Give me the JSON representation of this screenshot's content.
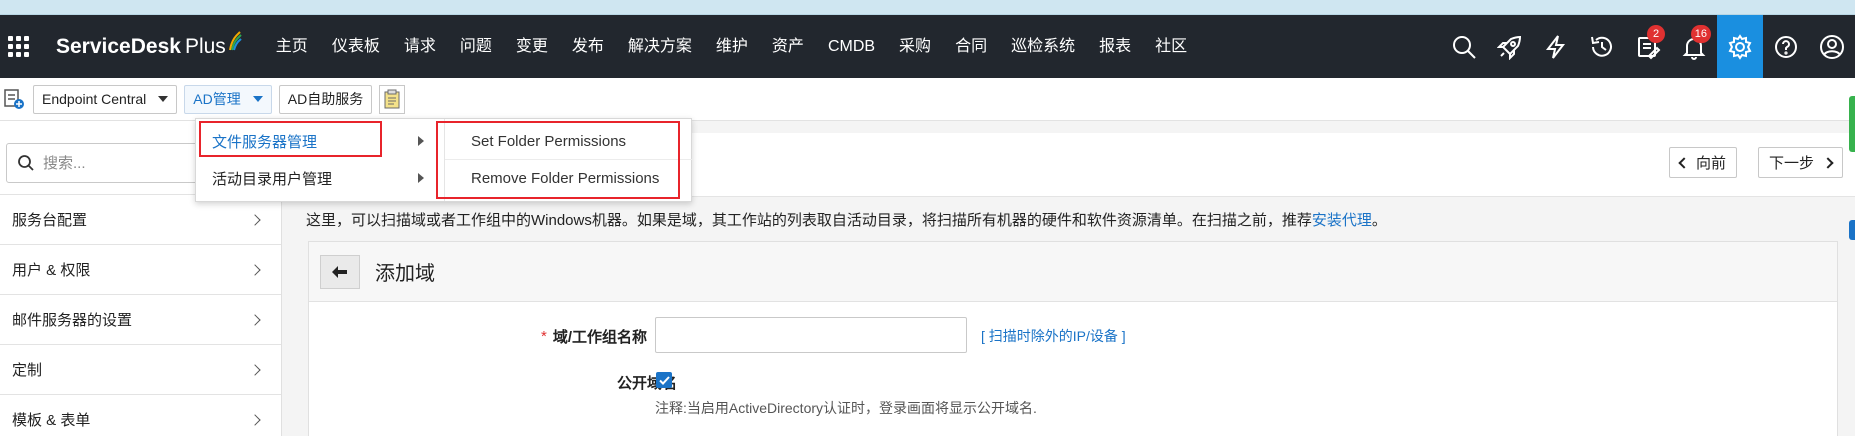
{
  "app": {
    "logo_text": "ServiceDesk",
    "logo_plus": "Plus"
  },
  "nav": {
    "items": [
      "主页",
      "仪表板",
      "请求",
      "问题",
      "变更",
      "发布",
      "解决方案",
      "维护",
      "资产",
      "CMDB",
      "采购",
      "合同",
      "巡检系统",
      "报表",
      "社区"
    ],
    "badges": {
      "tasks": "2",
      "notifications": "16"
    },
    "icons": [
      "search-icon",
      "rocket-icon",
      "lightning-icon",
      "history-icon",
      "tasks-icon",
      "bell-icon",
      "gear-icon",
      "help-icon",
      "user-icon"
    ]
  },
  "toolbar": {
    "endpoint_label": "Endpoint Central",
    "ad_manage_label": "AD管理",
    "ad_self_service_label": "AD自助服务"
  },
  "dropdown": {
    "items": [
      "文件服务器管理",
      "活动目录用户管理"
    ],
    "submenu": [
      "Set Folder Permissions",
      "Remove Folder Permissions"
    ]
  },
  "sidebar": {
    "search_placeholder": "搜索...",
    "items": [
      "服务台配置",
      "用户 & 权限",
      "邮件服务器的设置",
      "定制",
      "模板 & 表单"
    ]
  },
  "main": {
    "prev_label": "向前",
    "next_label": "下一步",
    "intro_text": "这里，可以扫描域或者工作组中的Windows机器。如果是域，其工作站的列表取自活动目录，将扫描所有机器的硬件和软件资源清单。在扫描之前，推荐",
    "intro_link": "安装代理",
    "intro_end": "。",
    "card_title": "添加域",
    "domain_label": "域/工作组名称",
    "required_mark": "*",
    "info_mark": "i",
    "exclude_link": "[ 扫描时除外的IP/设备 ]",
    "public_domain_label": "公开域名",
    "note": "注释:当启用ActiveDirectory认证时，登录画面将显示公开域名."
  },
  "colors": {
    "nav_bg": "#22272e",
    "accent": "#1a73c7",
    "active_gear": "#1a8fe0",
    "highlight": "#e8242b",
    "badge": "#e03131"
  }
}
